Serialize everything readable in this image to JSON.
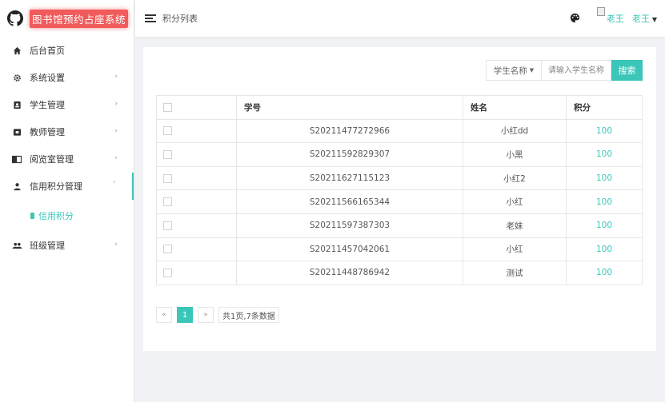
{
  "app": {
    "title": "图书馆预约占座系统"
  },
  "header": {
    "page_title": "积分列表",
    "avatar_alt": "老王",
    "user_name": "老王"
  },
  "sidebar": {
    "items": [
      {
        "label": "后台首页",
        "icon": "home-icon",
        "has_arrow": false
      },
      {
        "label": "系统设置",
        "icon": "gear-icon",
        "has_arrow": true
      },
      {
        "label": "学生管理",
        "icon": "id-badge-icon",
        "has_arrow": true
      },
      {
        "label": "教师管理",
        "icon": "teacher-icon",
        "has_arrow": true
      },
      {
        "label": "阅览室管理",
        "icon": "book-icon",
        "has_arrow": true
      },
      {
        "label": "信用积分管理",
        "icon": "user-icon",
        "has_arrow": true,
        "expanded": true
      },
      {
        "label": "班级管理",
        "icon": "users-icon",
        "has_arrow": true
      }
    ],
    "subitem": {
      "label": "信用积分"
    }
  },
  "search": {
    "select_label": "学生名称",
    "input_placeholder": "请输入学生名称",
    "input_value": "",
    "button_label": "搜索"
  },
  "table": {
    "columns": [
      "",
      "学号",
      "姓名",
      "积分"
    ],
    "rows": [
      {
        "id": "S20211477272966",
        "name": "小红dd",
        "score": "100"
      },
      {
        "id": "S20211592829307",
        "name": "小黑",
        "score": "100"
      },
      {
        "id": "S20211627115123",
        "name": "小红2",
        "score": "100"
      },
      {
        "id": "S20211566165344",
        "name": "小红",
        "score": "100"
      },
      {
        "id": "S20211597387303",
        "name": "老妹",
        "score": "100"
      },
      {
        "id": "S20211457042061",
        "name": "小红",
        "score": "100"
      },
      {
        "id": "S20211448786942",
        "name": "测试",
        "score": "100"
      }
    ]
  },
  "pagination": {
    "prev": "«",
    "current": "1",
    "next": "»",
    "info": "共1页,7条数据"
  },
  "colors": {
    "accent": "#3ac6b8",
    "brand_bg": "#f15b5b"
  }
}
